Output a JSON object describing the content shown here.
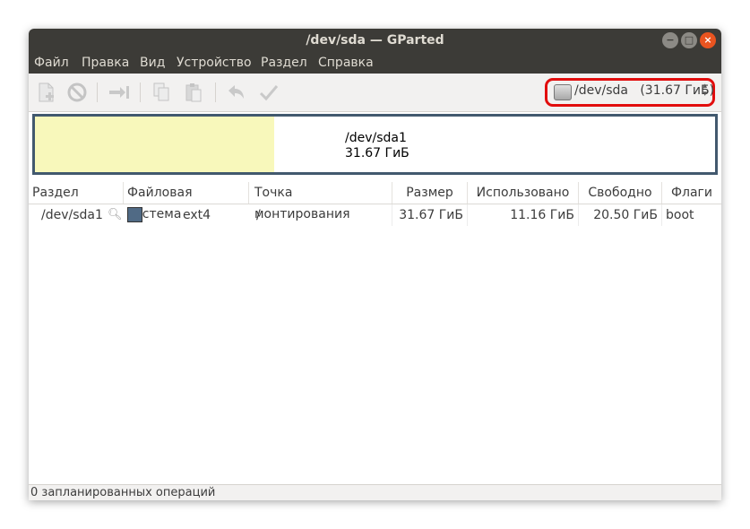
{
  "window": {
    "title": "/dev/sda — GParted"
  },
  "menu": [
    "Файл",
    "Правка",
    "Вид",
    "Устройство",
    "Раздел",
    "Справка"
  ],
  "toolbar": {
    "icons": [
      "new-partition-icon",
      "delete-icon",
      "resize-move-icon",
      "copy-icon",
      "paste-icon",
      "undo-icon",
      "apply-icon"
    ]
  },
  "device": {
    "label": "/dev/sda",
    "size": "(31.67 ГиБ)"
  },
  "disk_map": {
    "partition": "/dev/sda1",
    "size": "31.67 ГиБ",
    "used_fraction": 0.352,
    "used_color": "#f8f8bb",
    "border_color": "#42596e"
  },
  "table": {
    "columns": [
      "Раздел",
      "Файловая система",
      "Точка монтирования",
      "Размер",
      "Использовано",
      "Свободно",
      "Флаги"
    ],
    "rows": [
      {
        "partition": "/dev/sda1",
        "filesystem": "ext4",
        "fs_color": "#506a85",
        "mount": "/",
        "size": "31.67 ГиБ",
        "used": "11.16 ГиБ",
        "free": "20.50 ГиБ",
        "flags": "boot"
      }
    ]
  },
  "status": "0 запланированных операций"
}
